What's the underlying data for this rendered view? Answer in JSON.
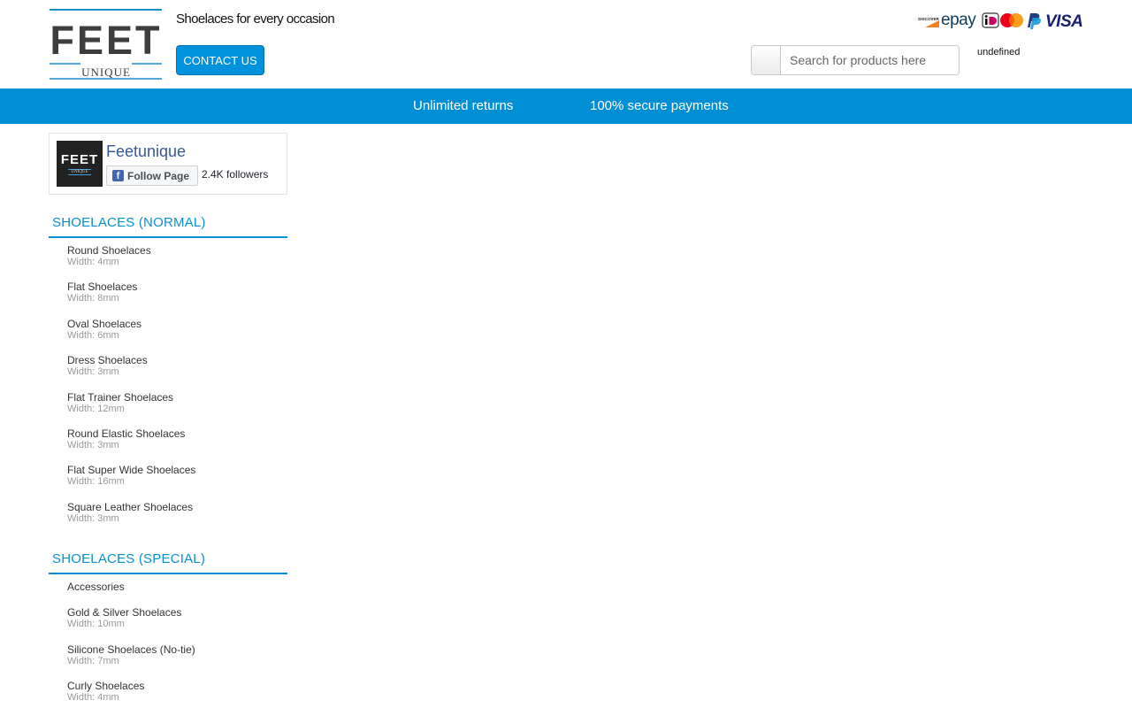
{
  "header": {
    "logo_text_main": "FEET",
    "logo_text_sub": "UNIQUE",
    "tagline": "Shoelaces for every occasion",
    "contact_label": "CONTACT US",
    "search_placeholder": "Search for products here",
    "undefined_text": "undefined",
    "payment_methods": [
      "discover-icon",
      "epay-icon",
      "ideal-icon",
      "mastercard-icon",
      "paypal-icon",
      "visa-icon"
    ],
    "payment_epay_label": "epay",
    "payment_visa_label": "VISA",
    "payment_discover_label": "DISCOVER"
  },
  "benefits": {
    "item1": "Unlimited returns",
    "item2": "100% secure payments"
  },
  "facebook": {
    "page_name": "Feetunique",
    "follow_label": "Follow Page",
    "followers": "2.4K followers",
    "avatar_main": "FEET",
    "avatar_sub": "UNIQUE"
  },
  "sidebar": {
    "normal_title": "SHOELACES (NORMAL)",
    "normal_items": [
      {
        "name": "Round Shoelaces",
        "width": "Width: 4mm"
      },
      {
        "name": "Flat Shoelaces",
        "width": "Width: 8mm"
      },
      {
        "name": "Oval Shoelaces",
        "width": "Width: 6mm"
      },
      {
        "name": "Dress Shoelaces",
        "width": "Width: 3mm"
      },
      {
        "name": "Flat Trainer Shoelaces",
        "width": "Width: 12mm"
      },
      {
        "name": "Round Elastic Shoelaces",
        "width": "Width: 3mm"
      },
      {
        "name": "Flat Super Wide Shoelaces",
        "width": "Width: 16mm"
      },
      {
        "name": "Square Leather Shoelaces",
        "width": "Width: 3mm"
      }
    ],
    "special_title": "SHOELACES (SPECIAL)",
    "special_items": [
      {
        "name": "Accessories",
        "width": ""
      },
      {
        "name": "Gold & Silver Shoelaces",
        "width": "Width: 10mm"
      },
      {
        "name": "Silicone Shoelaces (No-tie)",
        "width": "Width: 7mm"
      },
      {
        "name": "Curly Shoelaces",
        "width": "Width: 4mm"
      }
    ]
  },
  "colors": {
    "brand_blue": "#008fd5",
    "title_blue": "#0a8fd0",
    "facebook_blue": "#365899"
  }
}
